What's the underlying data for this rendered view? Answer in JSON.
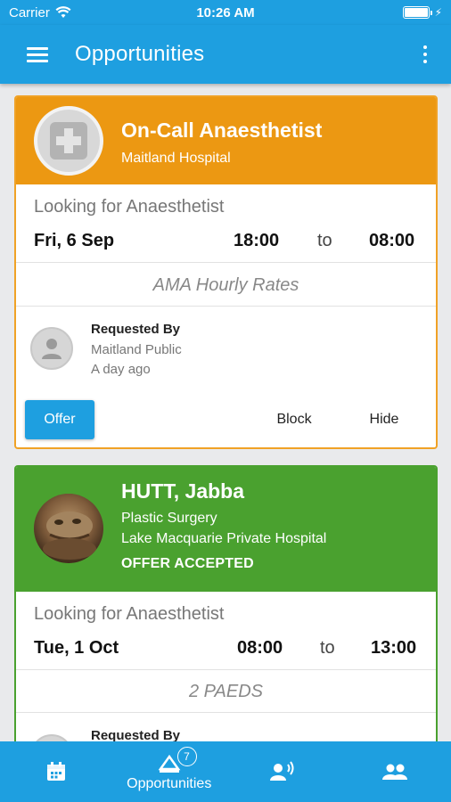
{
  "status_bar": {
    "carrier": "Carrier",
    "time": "10:26 AM"
  },
  "app_bar": {
    "title": "Opportunities"
  },
  "cards": [
    {
      "title": "On-Call Anaesthetist",
      "subtitle": "Maitland Hospital",
      "looking_for": "Looking for Anaesthetist",
      "date": "Fri, 6 Sep",
      "start_time": "18:00",
      "to_label": "to",
      "end_time": "08:00",
      "rate": "AMA Hourly Rates",
      "requested_by_label": "Requested By",
      "requested_by": "Maitland Public",
      "requested_when": "A day ago",
      "actions": {
        "offer": "Offer",
        "block": "Block",
        "hide": "Hide"
      }
    },
    {
      "title": "HUTT, Jabba",
      "specialty": "Plastic Surgery",
      "hospital": "Lake Macquarie Private Hospital",
      "status": "OFFER ACCEPTED",
      "looking_for": "Looking for Anaesthetist",
      "date": "Tue, 1 Oct",
      "start_time": "08:00",
      "to_label": "to",
      "end_time": "13:00",
      "rate": "2 PAEDS",
      "requested_by_label": "Requested By"
    }
  ],
  "tabbar": {
    "tabs": [
      {
        "icon": "calendar-icon",
        "label": ""
      },
      {
        "icon": "opportunities-icon",
        "label": "Opportunities",
        "badge": "7"
      },
      {
        "icon": "announce-icon",
        "label": ""
      },
      {
        "icon": "people-icon",
        "label": ""
      }
    ]
  },
  "colors": {
    "primary": "#1e9fe0",
    "card1_header": "#ec9812",
    "card2_header": "#4aa12f",
    "background": "#e9eaec"
  }
}
